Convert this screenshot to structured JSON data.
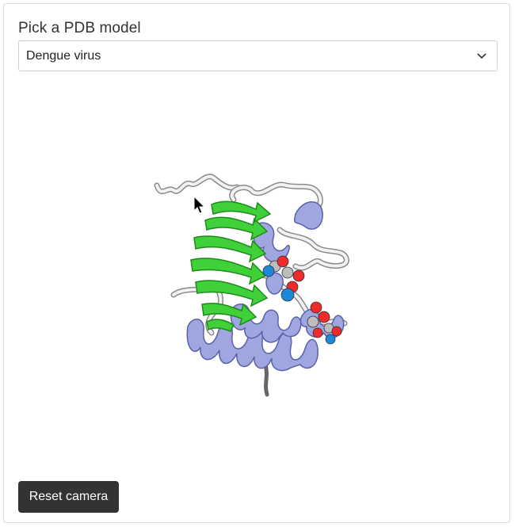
{
  "panel": {
    "title": "Pick a PDB model"
  },
  "model_select": {
    "selected": "Dengue virus",
    "icon": "chevron-down-icon"
  },
  "viewer": {
    "icons": [
      "mouse-cursor-icon"
    ],
    "colors": {
      "sheet": "#3fd03a",
      "helix": "#9fa6e0",
      "coil": "#c9c9c9",
      "oxygen": "#ee2a2a",
      "nitrogen": "#1e88d8",
      "carbon": "#bdbdbd"
    }
  },
  "controls": {
    "reset_label": "Reset camera"
  }
}
